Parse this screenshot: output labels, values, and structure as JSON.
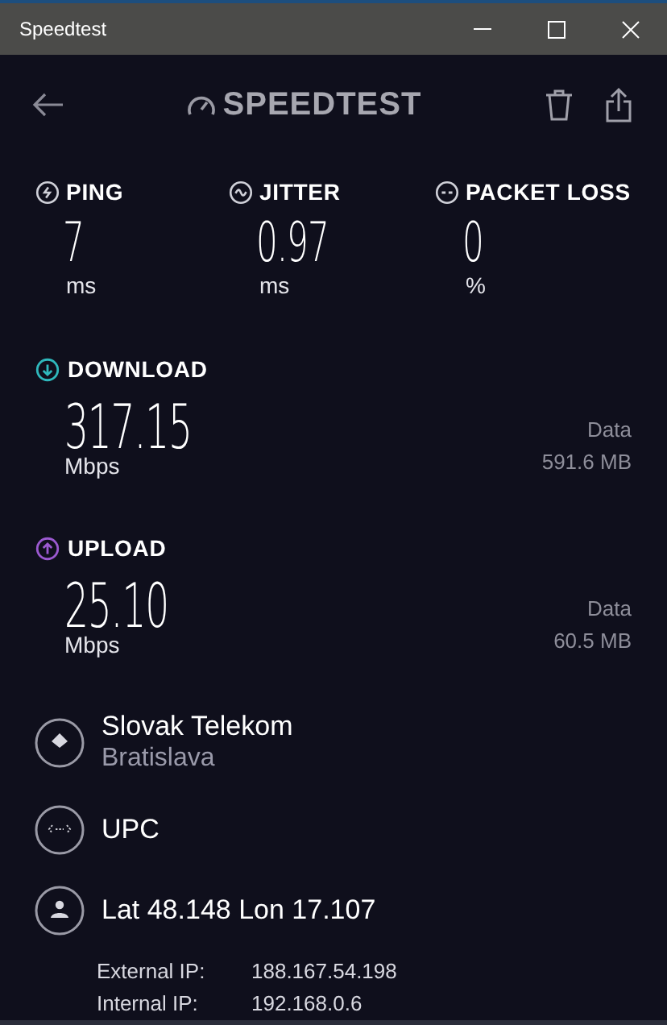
{
  "window": {
    "title": "Speedtest"
  },
  "header": {
    "logo": "SPEEDTEST"
  },
  "metrics": [
    {
      "kind": "ping",
      "label": "PING",
      "value": "7",
      "unit": "ms"
    },
    {
      "kind": "jitter",
      "label": "JITTER",
      "value": "0.97",
      "unit": "ms"
    },
    {
      "kind": "loss",
      "label": "PACKET LOSS",
      "value": "0",
      "unit": "%"
    }
  ],
  "speeds": [
    {
      "kind": "download",
      "label": "DOWNLOAD",
      "value": "317.15",
      "unit": "Mbps",
      "data_label": "Data",
      "data_value": "591.6 MB",
      "color": "#2fb8bc"
    },
    {
      "kind": "upload",
      "label": "UPLOAD",
      "value": "25.10",
      "unit": "Mbps",
      "data_label": "Data",
      "data_value": "60.5 MB",
      "color": "#9b59d0"
    }
  ],
  "details": [
    {
      "kind": "server",
      "title": "Slovak Telekom",
      "subtitle": "Bratislava"
    },
    {
      "kind": "provider",
      "title": "UPC"
    },
    {
      "kind": "location",
      "title": "Lat 48.148 Lon 17.107"
    }
  ],
  "ips": [
    {
      "label": "External IP:",
      "value": "188.167.54.198"
    },
    {
      "label": "Internal IP:",
      "value": "192.168.0.6"
    }
  ]
}
